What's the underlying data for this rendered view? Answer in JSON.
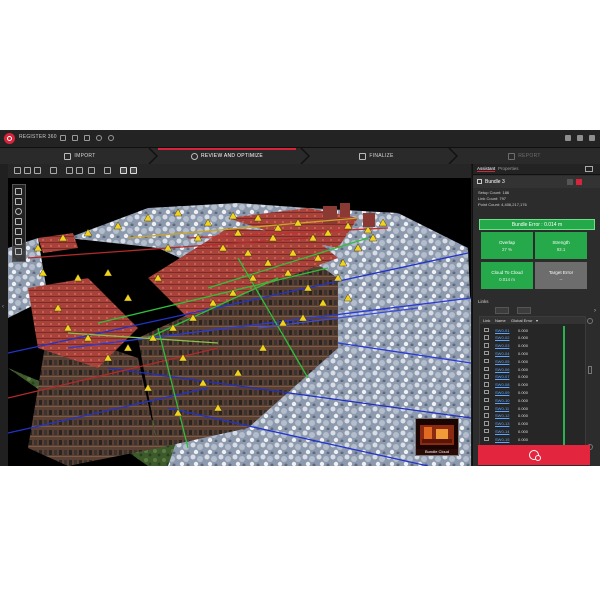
{
  "app": {
    "title": "REGISTER 360"
  },
  "workflow": {
    "steps": [
      {
        "label": "IMPORT",
        "state": "normal"
      },
      {
        "label": "REVIEW AND OPTIMIZE",
        "state": "active"
      },
      {
        "label": "FINALIZE",
        "state": "normal"
      },
      {
        "label": "REPORT",
        "state": "disabled"
      }
    ]
  },
  "viewport": {
    "thumbnail_label": "Bundle Cloud"
  },
  "panel": {
    "tabs": [
      "Assistant",
      "Properties"
    ],
    "bundle_name": "Bundle 3",
    "stats": [
      {
        "label": "Setup Count:",
        "value": "186"
      },
      {
        "label": "Link Count:",
        "value": "797"
      },
      {
        "label": "Point Count:",
        "value": "4,406,217,176"
      }
    ],
    "bundle_error": "Bundle Error : 0.014 m",
    "tiles": [
      {
        "label": "Overlap",
        "value": "27 %",
        "color": "green"
      },
      {
        "label": "Strength",
        "value": "93.1",
        "color": "green"
      },
      {
        "label": "Cloud To Cloud",
        "value": "0.014 m",
        "color": "green"
      },
      {
        "label": "Target Error",
        "value": "--",
        "color": "grey"
      }
    ],
    "links_label": "Links",
    "table_headers": [
      "Link",
      "Name",
      "Global Error"
    ],
    "rows": [
      {
        "name": "SW0-01",
        "error": "0.000"
      },
      {
        "name": "SW0-02",
        "error": "0.000"
      },
      {
        "name": "SW0-03",
        "error": "0.000"
      },
      {
        "name": "SW0-04",
        "error": "0.000"
      },
      {
        "name": "SW0-05",
        "error": "0.000"
      },
      {
        "name": "SW0-06",
        "error": "0.000"
      },
      {
        "name": "SW0-07",
        "error": "0.000"
      },
      {
        "name": "SW0-08",
        "error": "0.000"
      },
      {
        "name": "SW0-09",
        "error": "0.000"
      },
      {
        "name": "SW0-10",
        "error": "0.000"
      },
      {
        "name": "SW0-11",
        "error": "0.000"
      },
      {
        "name": "SW0-12",
        "error": "0.000"
      },
      {
        "name": "SW0-13",
        "error": "0.000"
      },
      {
        "name": "SW0-14",
        "error": "0.000"
      },
      {
        "name": "SW0-15",
        "error": "0.000"
      },
      {
        "name": "SW0-16",
        "error": "0.000"
      },
      {
        "name": "SW0-17",
        "error": "0.000"
      }
    ]
  },
  "colors": {
    "accent": "#d8243a",
    "good": "#25a94b",
    "neutral": "#6d6d6d",
    "link": "#5da6ff"
  }
}
